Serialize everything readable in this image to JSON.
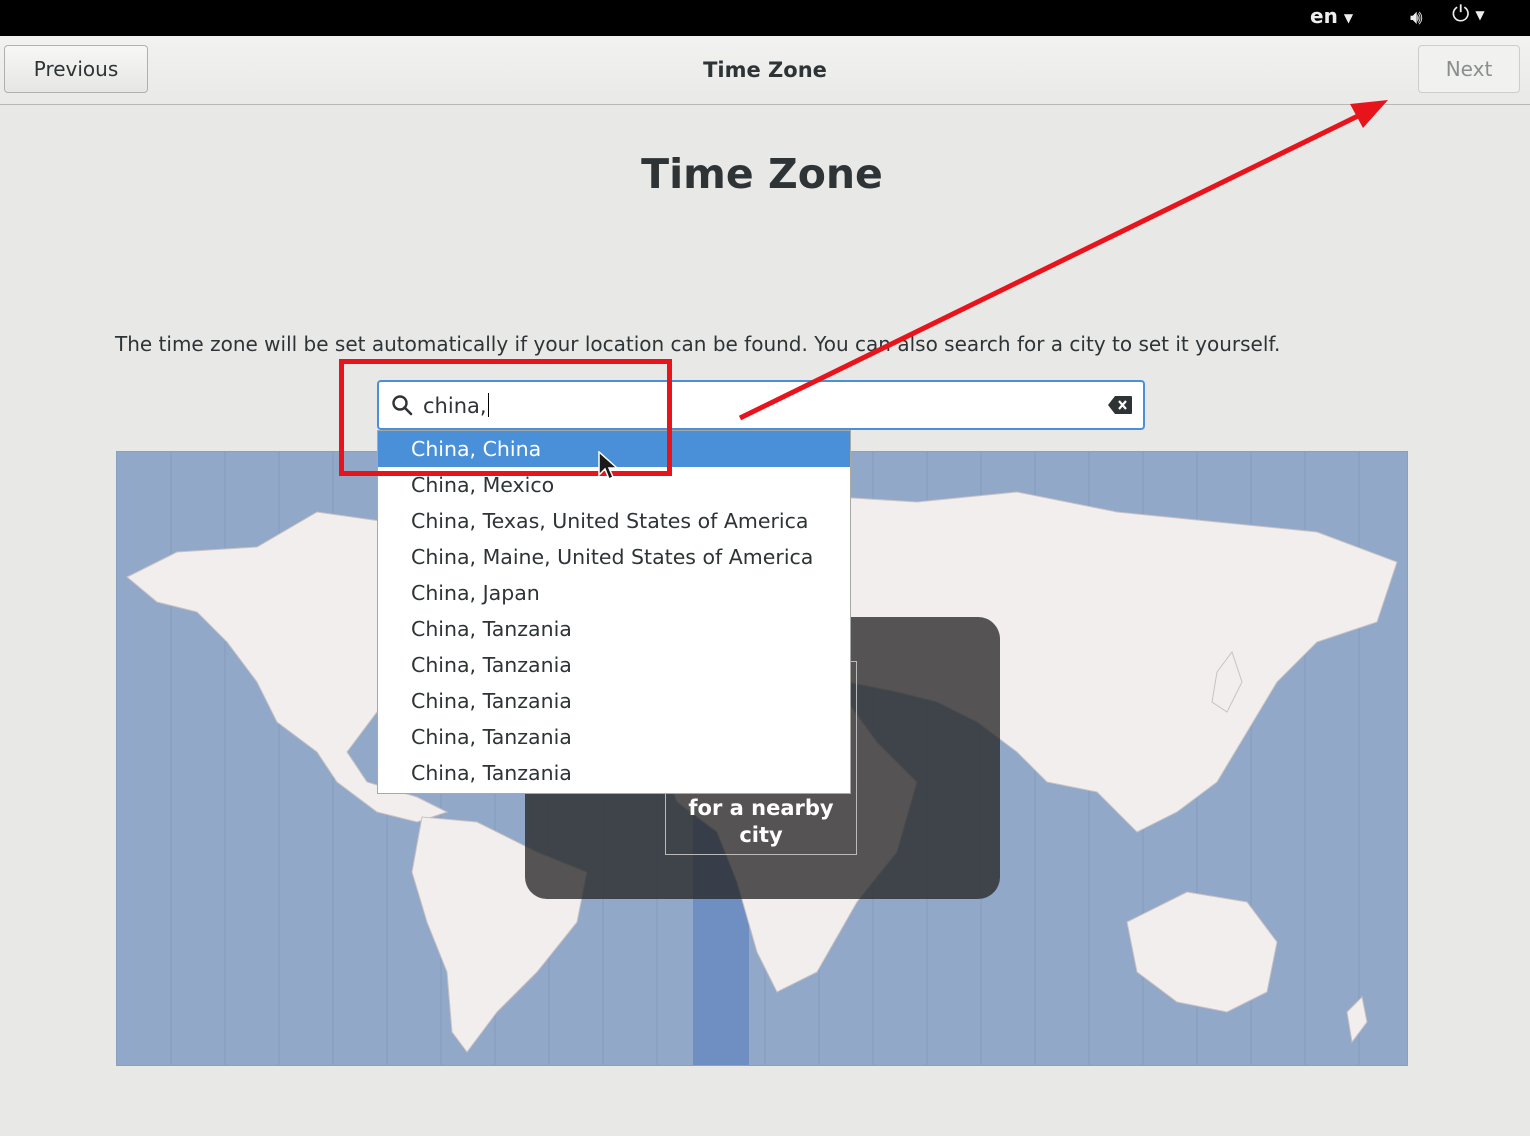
{
  "topbar": {
    "language": "en",
    "icons": [
      "volume-icon",
      "power-icon"
    ]
  },
  "header": {
    "previous_label": "Previous",
    "title": "Time Zone",
    "next_label": "Next"
  },
  "main": {
    "heading": "Time Zone",
    "description": "The time zone will be set automatically if your location can be found. You can also search for a city to set it yourself.",
    "search": {
      "value": "china,",
      "icon": "search-icon",
      "clear_icon": "clear-icon"
    },
    "results": [
      "China, China",
      "China, Mexico",
      "China, Texas, United States of America",
      "China, Maine, United States of America",
      "China, Japan",
      "China, Tanzania",
      "China, Tanzania",
      "China, Tanzania",
      "China, Tanzania",
      "China, Tanzania"
    ],
    "selected_index": 0,
    "map_overlay_text": "for a nearby city"
  },
  "colors": {
    "accent": "#4a90d9",
    "map_ocean": "#91a8c8",
    "land": "#f3eeee",
    "annotation": "#e8141c"
  }
}
